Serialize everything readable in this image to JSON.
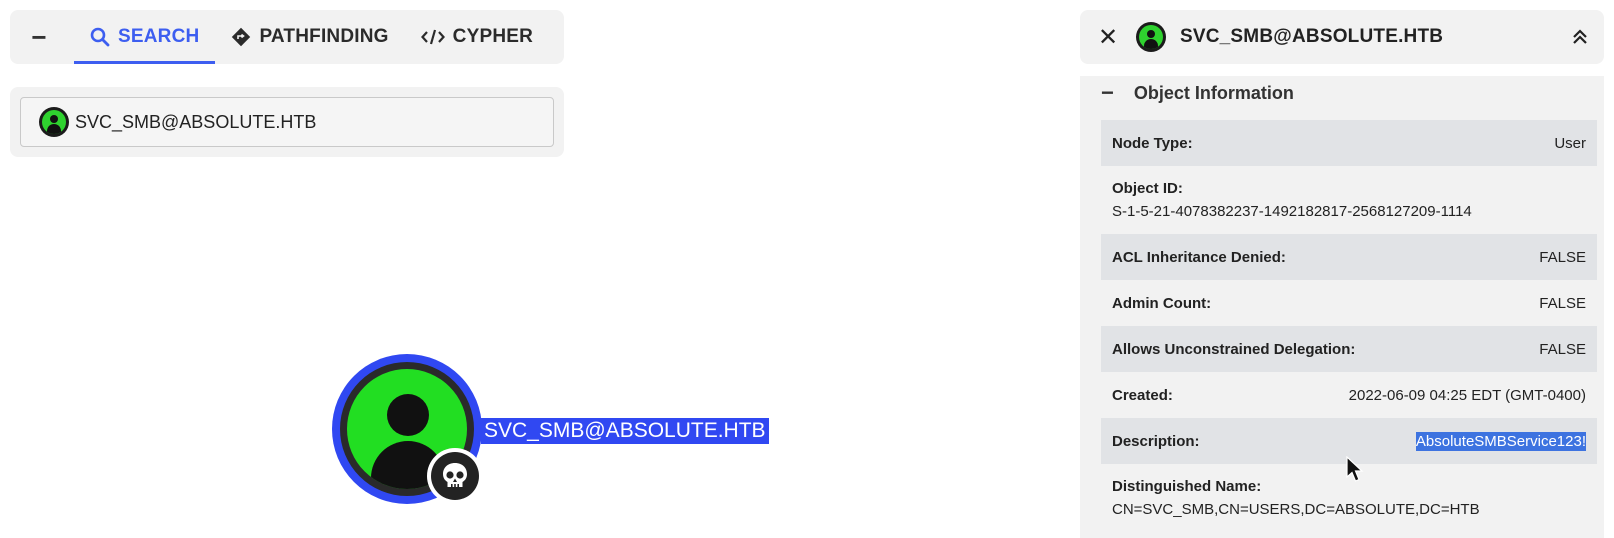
{
  "tabs": {
    "collapse_label": "−",
    "items": [
      {
        "label": "SEARCH",
        "icon": "search-icon",
        "active": true
      },
      {
        "label": "PATHFINDING",
        "icon": "diamond-direction-icon"
      },
      {
        "label": "CYPHER",
        "icon": "code-icon"
      }
    ]
  },
  "search": {
    "value": "SVC_SMB@ABSOLUTE.HTB",
    "icon": "user-icon"
  },
  "graph": {
    "node_label": "SVC_SMB@ABSOLUTE.HTB",
    "node_icon": "user-icon",
    "badge_icon": "skull-icon"
  },
  "panel": {
    "close_label": "✕",
    "title": "SVC_SMB@ABSOLUTE.HTB",
    "section": {
      "toggle": "−",
      "title": "Object Information"
    },
    "rows": [
      {
        "key": "Node Type:",
        "value": "User"
      },
      {
        "key": "Object ID:",
        "value": "S-1-5-21-4078382237-1492182817-2568127209-1114"
      },
      {
        "key": "ACL Inheritance Denied:",
        "value": "FALSE"
      },
      {
        "key": "Admin Count:",
        "value": "FALSE"
      },
      {
        "key": "Allows Unconstrained Delegation:",
        "value": "FALSE"
      },
      {
        "key": "Created:",
        "value": "2022-06-09 04:25 EDT (GMT-0400)"
      },
      {
        "key": "Description:",
        "value": "AbsoluteSMBService123!"
      },
      {
        "key": "Distinguished Name:",
        "value": "CN=SVC_SMB,CN=USERS,DC=ABSOLUTE,DC=HTB"
      }
    ]
  },
  "colors": {
    "accent": "#3d5ef0",
    "node_fill": "#22de22",
    "selection": "#3048f2"
  }
}
